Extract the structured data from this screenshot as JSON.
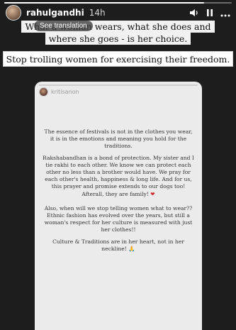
{
  "story": {
    "progress_fraction": 0.88,
    "username": "rahulgandhi",
    "age": "14h",
    "icons": [
      "avatar",
      "volume-icon",
      "pause-icon",
      "more-icon"
    ]
  },
  "caption": {
    "line1": "What a woman wears, what she does and",
    "line2": "where she goes - is her choice.",
    "see_translation": "See translation",
    "line3": "Stop trolling women for exercising their freedom."
  },
  "embedded_story": {
    "username": "kritisanon",
    "paragraphs": [
      "The essence of festivals is not in the clothes you wear, it is in the emotions and meaning you hold for the traditions.",
      "Rakshabandhan is a bond of protection. My sister and I tie rakhi to each other. We know we can protect each other no less than a brother would have. We pray for each other's health, happiness & long life. And for us, this prayer and promise extends to our dogs too! Afterall, they are family!",
      "Also, when will we stop telling women what to wear?? Ethnic fashion has evolved over the years, but still a woman's respect for her culture is measured with just her clothes!!",
      "Culture & Traditions are in her heart, not in her neckline!"
    ],
    "emojis": {
      "heart": "❤",
      "folded_hands": "🙏"
    },
    "colors": {
      "background": "#ebebeb",
      "heart": "#d1262a"
    }
  }
}
